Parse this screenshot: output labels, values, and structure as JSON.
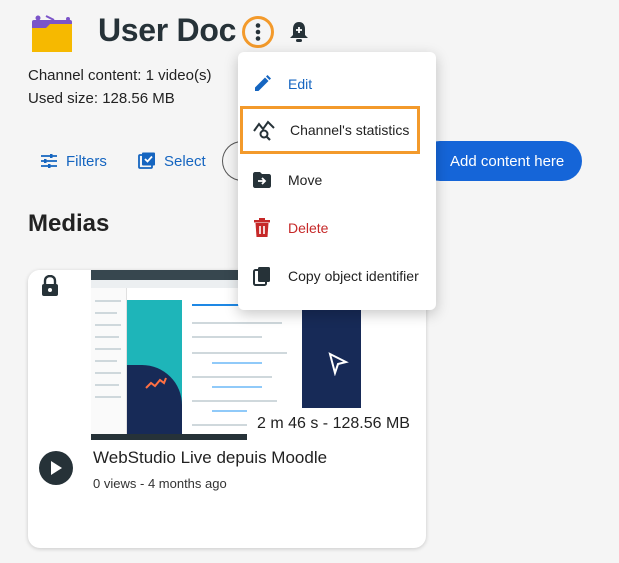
{
  "header": {
    "title": "User Doc",
    "channel_content": "Channel content: 1 video(s)",
    "used_size": "Used size: 128.56 MB"
  },
  "toolbar": {
    "filters_label": "Filters",
    "select_label": "Select",
    "add_label": "Add content here"
  },
  "section": {
    "title": "Medias"
  },
  "media": {
    "title": "WebStudio Live depuis Moodle",
    "duration": "2 m 46 s - 128.56 MB",
    "views": "0 views",
    "age": "4 months ago"
  },
  "menu": {
    "items": [
      {
        "label": "Edit"
      },
      {
        "label": "Channel's statistics"
      },
      {
        "label": "Move"
      },
      {
        "label": "Delete"
      },
      {
        "label": "Copy object identifier"
      }
    ]
  },
  "colors": {
    "accent": "#1565c0",
    "highlight": "#f39a2b",
    "danger": "#c62828"
  }
}
